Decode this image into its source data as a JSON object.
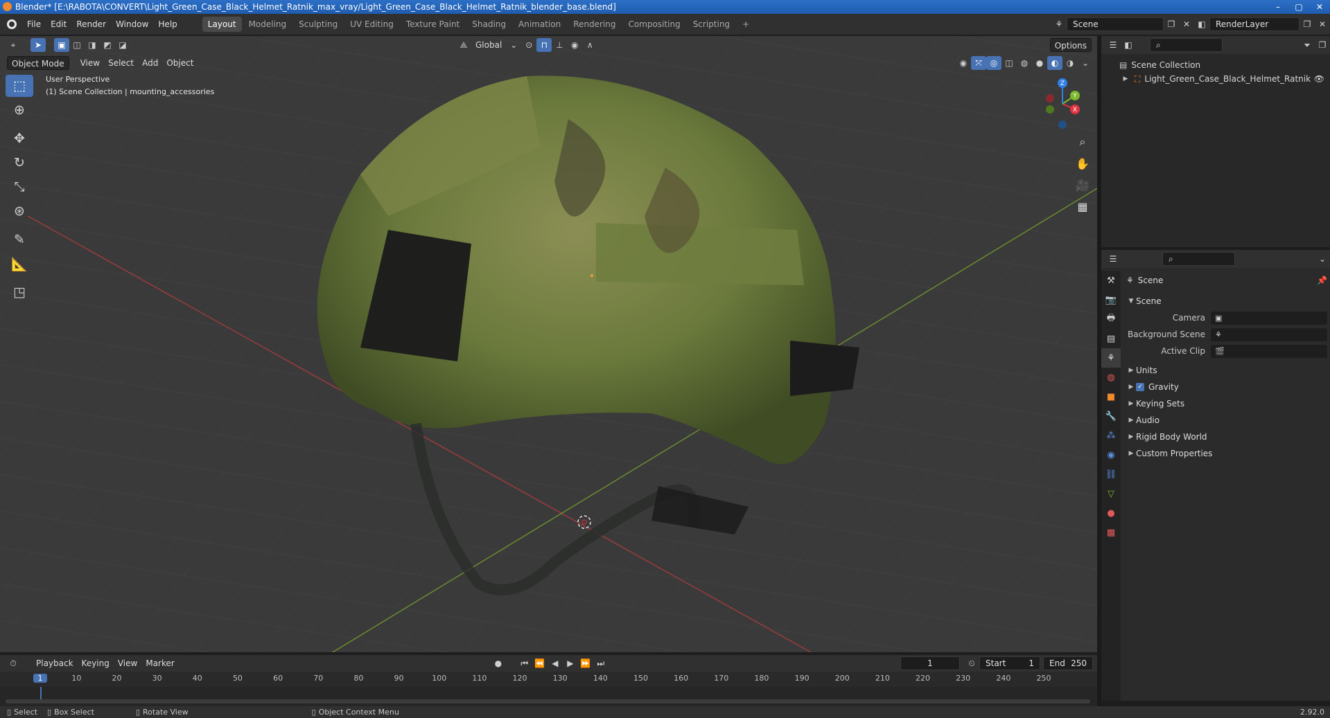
{
  "window": {
    "title": "Blender* [E:\\RABOTA\\CONVERT\\Light_Green_Case_Black_Helmet_Ratnik_max_vray/Light_Green_Case_Black_Helmet_Ratnik_blender_base.blend]",
    "buttons": [
      "–",
      "▢",
      "✕"
    ]
  },
  "menus": [
    "File",
    "Edit",
    "Render",
    "Window",
    "Help"
  ],
  "workspaces": [
    "Layout",
    "Modeling",
    "Sculpting",
    "UV Editing",
    "Texture Paint",
    "Shading",
    "Animation",
    "Rendering",
    "Compositing",
    "Scripting"
  ],
  "active_workspace": "Layout",
  "scene_name": "Scene",
  "view_layer": "RenderLayer",
  "viewport": {
    "transform_orientation": "Global",
    "options_label": "Options",
    "mode": "Object Mode",
    "header_menus": [
      "View",
      "Select",
      "Add",
      "Object"
    ],
    "view_name": "User Perspective",
    "collection_info": "(1) Scene Collection | mounting_accessories",
    "gizmo_axes": {
      "x": "X",
      "y": "Y",
      "z": "Z"
    }
  },
  "outliner": {
    "root": "Scene Collection",
    "items": [
      {
        "name": "Light_Green_Case_Black_Helmet_Ratnik"
      }
    ]
  },
  "properties": {
    "context_name": "Scene",
    "panel": "Scene",
    "fields": [
      {
        "label": "Camera",
        "value": ""
      },
      {
        "label": "Background Scene",
        "value": ""
      },
      {
        "label": "Active Clip",
        "value": ""
      }
    ],
    "subpanels": [
      {
        "label": "Units",
        "checkbox": false
      },
      {
        "label": "Gravity",
        "checkbox": true
      },
      {
        "label": "Keying Sets",
        "checkbox": false
      },
      {
        "label": "Audio",
        "checkbox": false
      },
      {
        "label": "Rigid Body World",
        "checkbox": false
      },
      {
        "label": "Custom Properties",
        "checkbox": false
      }
    ]
  },
  "timeline": {
    "menus": [
      "Playback",
      "Keying",
      "View",
      "Marker"
    ],
    "current_frame": "1",
    "start_label": "Start",
    "start": "1",
    "end_label": "End",
    "end": "250",
    "ticks": [
      "1",
      "10",
      "20",
      "30",
      "40",
      "50",
      "60",
      "70",
      "80",
      "90",
      "100",
      "110",
      "120",
      "130",
      "140",
      "150",
      "160",
      "170",
      "180",
      "190",
      "200",
      "210",
      "220",
      "230",
      "240",
      "250"
    ]
  },
  "status": {
    "items": [
      "Select",
      "Box Select",
      "Rotate View",
      "Object Context Menu"
    ],
    "version": "2.92.0"
  },
  "colors": {
    "accent": "#4772b3",
    "x_axis": "#e0343f",
    "y_axis": "#7ab82d",
    "z_axis": "#2e7fe6",
    "helmet_base": "#6b7a3c"
  }
}
